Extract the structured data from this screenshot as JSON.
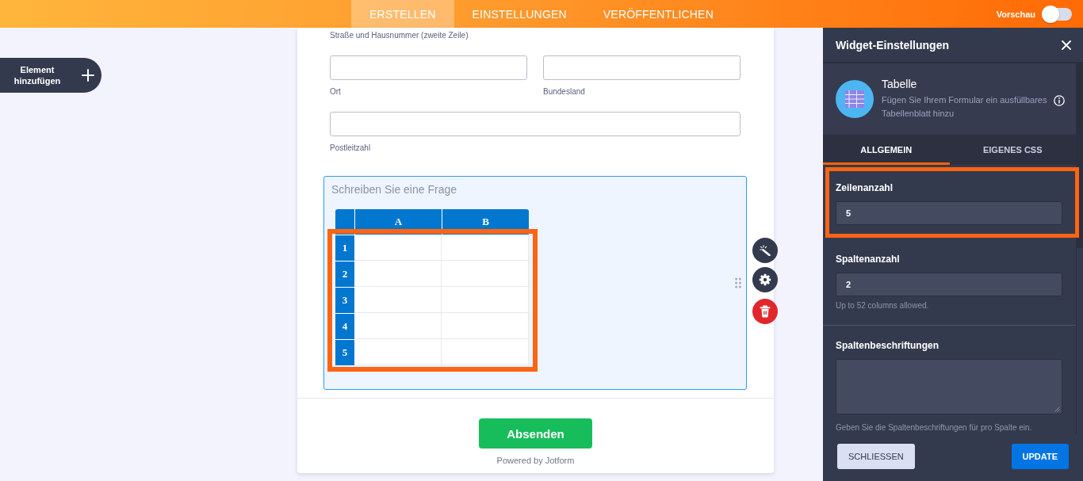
{
  "top_bar": {
    "tabs": [
      {
        "label": "ERSTELLEN",
        "selected": true
      },
      {
        "label": "EINSTELLUNGEN",
        "selected": false
      },
      {
        "label": "VERÖFFENTLICHEN",
        "selected": false
      }
    ],
    "preview": {
      "label": "Vorschau",
      "on": false
    }
  },
  "add_element": {
    "label": "Element hinzufügen"
  },
  "form": {
    "top_label": "Straße und Hausnummer (zweite Zeile)",
    "rows": [
      {
        "fields": [
          {
            "label": "Ort"
          },
          {
            "label": "Bundesland"
          }
        ]
      },
      {
        "fields": [
          {
            "label": "Postleitzahl"
          }
        ]
      }
    ],
    "table_question": {
      "selected": true,
      "placeholder": "Schreiben Sie eine Frage",
      "columns": [
        "A",
        "B"
      ],
      "rows": [
        "1",
        "2",
        "3",
        "4",
        "5"
      ],
      "rows_highlighted": true
    },
    "submit": {
      "label": "Absenden"
    },
    "powered_by": "Powered by Jotform"
  },
  "panel": {
    "title": "Widget-Einstellungen",
    "widget": {
      "name": "Tabelle",
      "description": "Fügen Sie Ihrem Formular ein ausfüllbares Tabellenblatt hinzu"
    },
    "tabs": [
      {
        "label": "ALLGEMEIN",
        "selected": true
      },
      {
        "label": "EIGENES CSS",
        "selected": false
      }
    ],
    "sections": [
      {
        "settings": [
          {
            "kind": "number",
            "label": "Zeilenanzahl",
            "value": "5",
            "highlighted": true
          },
          {
            "kind": "number",
            "label": "Spaltenanzahl",
            "value": "2",
            "hint": "Up to 52 columns allowed.",
            "highlighted": false
          }
        ]
      },
      {
        "settings": [
          {
            "kind": "textarea",
            "label": "Spaltenbeschriftungen",
            "hint": "Geben Sie die Spaltenbeschriftungen für pro Spalte ein.",
            "highlighted": false
          }
        ]
      }
    ],
    "buttons": [
      {
        "kind": "close",
        "label": "SCHLIESSEN"
      },
      {
        "kind": "update",
        "label": "UPDATE"
      }
    ]
  }
}
